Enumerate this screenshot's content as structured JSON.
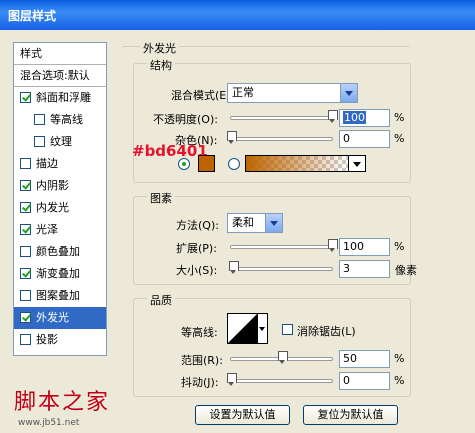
{
  "window": {
    "title": "图层样式"
  },
  "left_panel": {
    "header": "样式",
    "blend_options": "混合选项:默认",
    "items": [
      {
        "label": "斜面和浮雕",
        "checked": true
      },
      {
        "label": "等高线",
        "checked": false
      },
      {
        "label": "纹理",
        "checked": false
      },
      {
        "label": "描边",
        "checked": false
      },
      {
        "label": "内阴影",
        "checked": true
      },
      {
        "label": "内发光",
        "checked": true
      },
      {
        "label": "光泽",
        "checked": true
      },
      {
        "label": "颜色叠加",
        "checked": false
      },
      {
        "label": "渐变叠加",
        "checked": true
      },
      {
        "label": "图案叠加",
        "checked": false
      },
      {
        "label": "外发光",
        "checked": true,
        "selected": true
      },
      {
        "label": "投影",
        "checked": false
      }
    ]
  },
  "outer_glow": {
    "title": "外发光",
    "structure": {
      "title": "结构",
      "blend_mode_label": "混合模式(E):",
      "blend_mode_value": "正常",
      "opacity_label": "不透明度(O):",
      "opacity_value": "100",
      "opacity_unit": "%",
      "opacity_fraction": 1.0,
      "noise_label": "杂色(N):",
      "noise_value": "0",
      "noise_unit": "%",
      "noise_fraction": 0.0,
      "color_annotation": "#bd6401",
      "glow_color": "#bd6401"
    },
    "elements": {
      "title": "图素",
      "method_label": "方法(Q):",
      "method_value": "柔和",
      "spread_label": "扩展(P):",
      "spread_value": "100",
      "spread_unit": "%",
      "spread_fraction": 1.0,
      "size_label": "大小(S):",
      "size_value": "3",
      "size_unit": "像素",
      "size_fraction": 0.02
    },
    "quality": {
      "title": "品质",
      "contour_label": "等高线:",
      "antialias_label": "消除锯齿(L)",
      "range_label": "范围(R):",
      "range_value": "50",
      "range_unit": "%",
      "range_fraction": 0.5,
      "jitter_label": "抖动(J):",
      "jitter_value": "0",
      "jitter_unit": "%",
      "jitter_fraction": 0.0
    },
    "buttons": {
      "set_default": "设置为默认值",
      "reset_default": "复位为默认值"
    }
  },
  "watermark": {
    "text": "脚本之家",
    "url": "www.jb51.net"
  },
  "colors": {
    "accent": "#316ac5",
    "annotation": "#e8102a"
  }
}
